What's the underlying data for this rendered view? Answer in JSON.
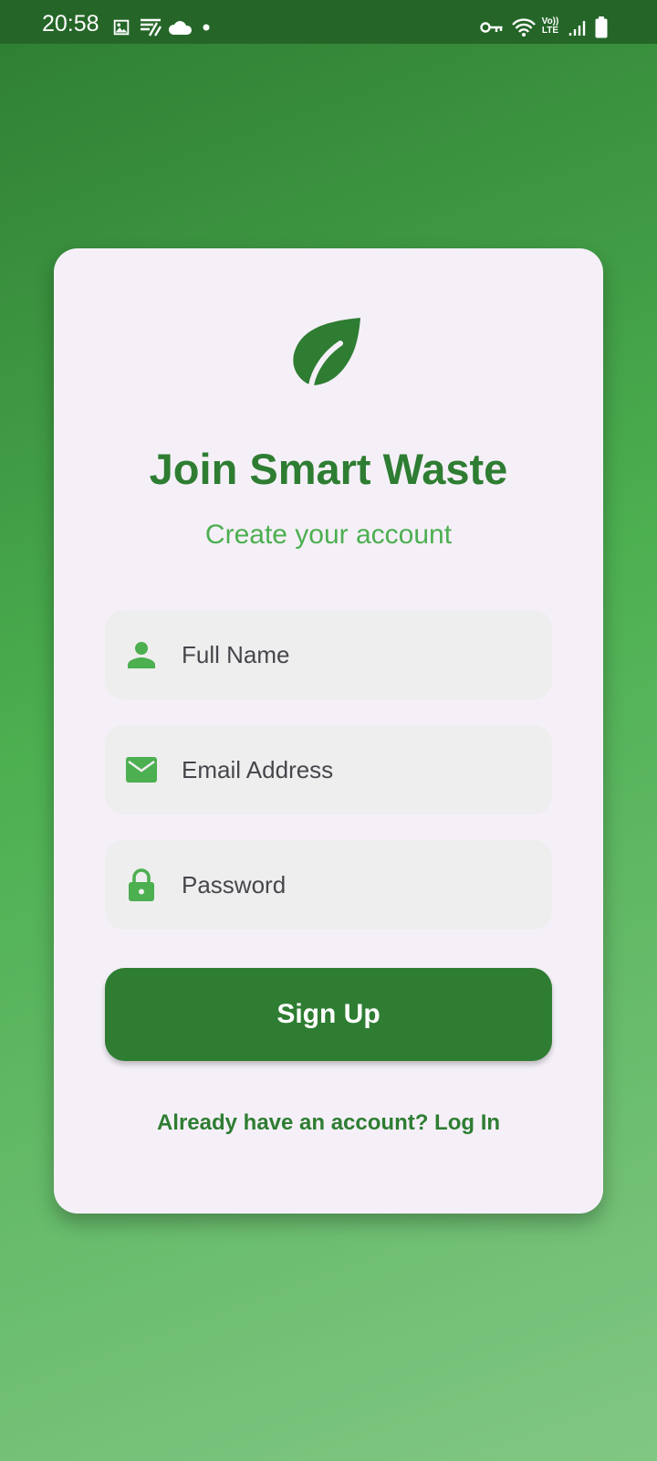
{
  "status_bar": {
    "time": "20:58",
    "left_icons": [
      "image-icon",
      "sync-icon",
      "cloud-icon",
      "dot-icon"
    ],
    "right_icons": [
      "vpn-key-icon",
      "wifi-icon",
      "volte-icon",
      "signal-icon",
      "battery-icon"
    ],
    "volte_top": "Vo))",
    "volte_bottom": "LTE"
  },
  "card": {
    "logo_icon": "leaf-icon",
    "title": "Join Smart Waste",
    "subtitle": "Create your account",
    "fields": [
      {
        "icon": "person-icon",
        "placeholder": "Full Name",
        "value": ""
      },
      {
        "icon": "mail-icon",
        "placeholder": "Email Address",
        "value": ""
      },
      {
        "icon": "lock-icon",
        "placeholder": "Password",
        "value": ""
      }
    ],
    "signup_label": "Sign Up",
    "login_prompt": "Already have an account? Log In"
  },
  "colors": {
    "primary": "#2e7d32",
    "accent": "#4caf50",
    "card_background": "#f5f0f8",
    "field_background": "#eeeeee",
    "status_bar": "#256628"
  }
}
